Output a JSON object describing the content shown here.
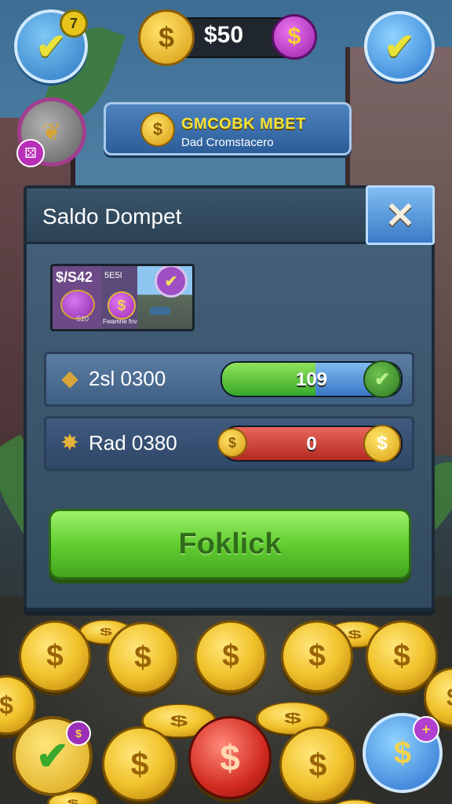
{
  "hud": {
    "level_badge": "7",
    "currency_symbol": "$",
    "money": "$50",
    "add_money_symbol": "$",
    "check_symbol": "✔",
    "dice_symbol": "⚄"
  },
  "banner": {
    "coin_symbol": "$",
    "title": "GMCOBK MBET",
    "subtitle": "Dad Cromstacero"
  },
  "panel": {
    "title": "Saldo Dompet",
    "close_symbol": "✕",
    "card": {
      "amount": "$/S42",
      "code": "5E5I",
      "caption": "Fwamne fnv",
      "small": "S20",
      "coin_symbol": "$",
      "check_symbol": "✔"
    },
    "rows": [
      {
        "icon": "gem-icon",
        "label": "2sl 0300",
        "value": "109",
        "fill": 0.52,
        "end_symbol": "✔",
        "colors": {
          "fill": "#37a82a",
          "rest": "#3a77c6"
        }
      },
      {
        "icon": "sparkle-icon",
        "label": "Rad 0380",
        "value": "0",
        "fill": 1.0,
        "start_symbol": "$",
        "end_symbol": "$",
        "colors": {
          "fill": "#b52a22"
        }
      }
    ],
    "action_button": "Foklick"
  },
  "bottom": {
    "coin_symbol": "$",
    "check_symbol": "✔",
    "mini_symbol": "$",
    "exchange_symbol": "$",
    "plus_symbol": "+"
  },
  "colors": {
    "accent_green": "#63cf32",
    "accent_gold": "#f1c22b",
    "panel_bg": "#3a5469",
    "banner_text": "#f4e23b"
  }
}
